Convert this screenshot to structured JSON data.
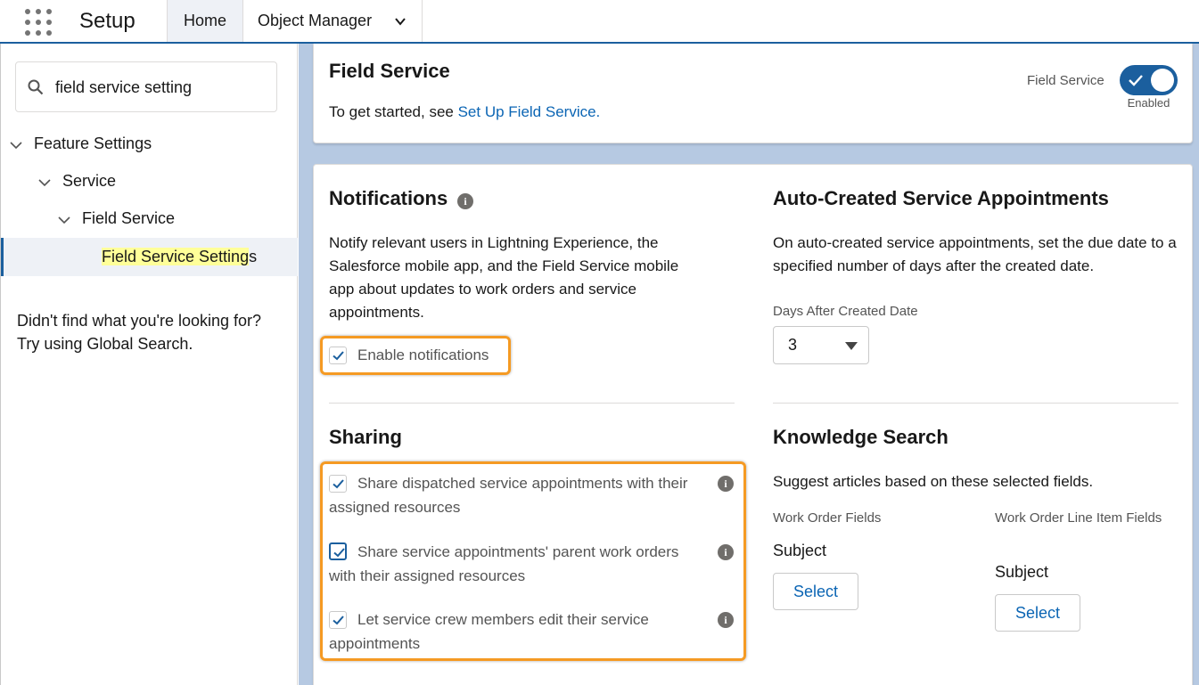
{
  "topbar": {
    "app_title": "Setup",
    "tabs": [
      {
        "label": "Home",
        "active": true
      },
      {
        "label": "Object Manager",
        "active": false
      }
    ]
  },
  "sidebar": {
    "search": {
      "value": "field service setting"
    },
    "tree": {
      "feature_settings": "Feature Settings",
      "service": "Service",
      "field_service": "Field Service",
      "selected_match": "Field Service Setting",
      "selected_rest": "s"
    },
    "not_found_line1": "Didn't find what you're looking for?",
    "not_found_line2": "Try using Global Search."
  },
  "header": {
    "title": "Field Service",
    "intro_prefix": "To get started, see ",
    "intro_link": "Set Up Field Service.",
    "toggle_label": "Field Service",
    "toggle_state": "Enabled"
  },
  "notifications": {
    "title": "Notifications",
    "description": "Notify relevant users in Lightning Experience, the Salesforce mobile app, and the Field Service mobile app about updates to work orders and service appointments.",
    "checkbox_label": "Enable notifications",
    "checked": true
  },
  "auto_created": {
    "title": "Auto-Created Service Appointments",
    "description": "On auto-created service appointments, set the due date to a specified number of days after the created date.",
    "field_label": "Days After Created Date",
    "selected_value": "3"
  },
  "sharing": {
    "title": "Sharing",
    "options": [
      {
        "label": "Share dispatched service appointments with their assigned resources",
        "checked": true
      },
      {
        "label": "Share service appointments' parent work orders with their assigned resources",
        "checked": true
      },
      {
        "label": "Let service crew members edit their service appointments",
        "checked": true
      }
    ]
  },
  "knowledge": {
    "title": "Knowledge Search",
    "description": "Suggest articles based on these selected fields.",
    "work_order_label": "Work Order Fields",
    "work_order_value": "Subject",
    "line_item_label": "Work Order Line Item Fields",
    "line_item_value": "Subject",
    "select_label": "Select"
  },
  "colors": {
    "brand": "#1b5f9e",
    "link": "#0b65b4",
    "highlight_box": "#f59a23",
    "search_highlight": "#ffff99"
  }
}
